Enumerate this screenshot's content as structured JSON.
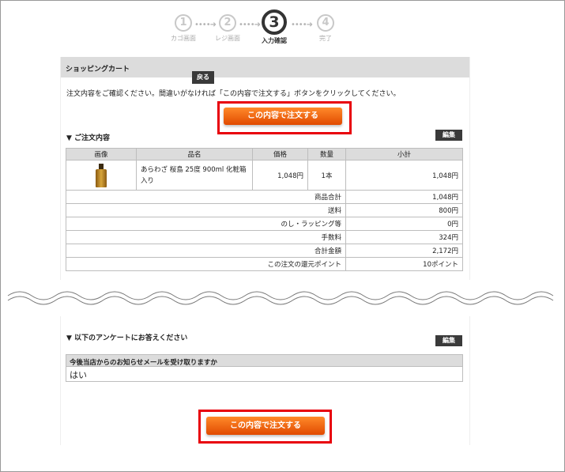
{
  "steps": [
    {
      "num": "1",
      "label": "カゴ画面"
    },
    {
      "num": "2",
      "label": "レジ画面"
    },
    {
      "num": "3",
      "label": "入力確認"
    },
    {
      "num": "4",
      "label": "完了"
    }
  ],
  "step_arrow": "••••➜",
  "cart": {
    "header": "ショッピングカート",
    "intro": "注文内容をご確認ください。間違いがなければ「この内容で注文する」ボタンをクリックしてください。",
    "back_label": "戻る",
    "order_label": "この内容で注文する"
  },
  "order_section": {
    "title": "▼ ご注文内容",
    "edit_label": "編集",
    "columns": [
      "画像",
      "品名",
      "価格",
      "数量",
      "小計"
    ],
    "item": {
      "name": "あらわざ 桜島 25度 900ml 化粧箱入り",
      "price": "1,048円",
      "qty": "1本",
      "subtotal": "1,048円"
    },
    "summary": [
      {
        "label": "商品合計",
        "value": "1,048円"
      },
      {
        "label": "送料",
        "value": "800円"
      },
      {
        "label": "のし・ラッピング等",
        "value": "0円"
      },
      {
        "label": "手数料",
        "value": "324円"
      },
      {
        "label": "合計金額",
        "value": "2,172円"
      },
      {
        "label": "この注文の還元ポイント",
        "value": "10ポイント"
      }
    ]
  },
  "survey": {
    "title": "▼ 以下のアンケートにお答えください",
    "edit_label": "編集",
    "question": "今後当店からのお知らせメールを受け取りますか",
    "answer": "はい"
  },
  "bottom_order_label": "この内容で注文する"
}
